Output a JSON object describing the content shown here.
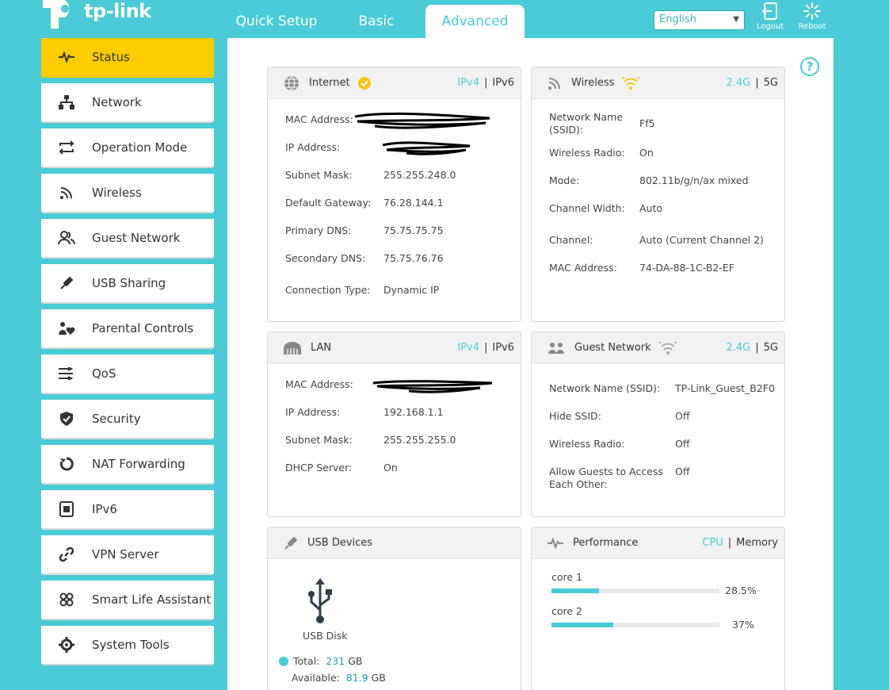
{
  "header": {
    "logo_text": "tp-link",
    "tabs": [
      {
        "label": "Quick Setup"
      },
      {
        "label": "Basic"
      },
      {
        "label": "Advanced"
      }
    ],
    "language": "English",
    "logout_label": "Logout",
    "reboot_label": "Reboot"
  },
  "sidebar": {
    "items": [
      {
        "label": "Status",
        "icon": "pulse-icon"
      },
      {
        "label": "Network",
        "icon": "network-icon"
      },
      {
        "label": "Operation Mode",
        "icon": "mode-icon"
      },
      {
        "label": "Wireless",
        "icon": "wireless-icon"
      },
      {
        "label": "Guest Network",
        "icon": "guest-icon"
      },
      {
        "label": "USB Sharing",
        "icon": "usb-icon"
      },
      {
        "label": "Parental Controls",
        "icon": "parental-icon"
      },
      {
        "label": "QoS",
        "icon": "qos-icon"
      },
      {
        "label": "Security",
        "icon": "shield-icon"
      },
      {
        "label": "NAT Forwarding",
        "icon": "nat-icon"
      },
      {
        "label": "IPv6",
        "icon": "ipv6-icon"
      },
      {
        "label": "VPN Server",
        "icon": "link-icon"
      },
      {
        "label": "Smart Life Assistant",
        "icon": "clover-icon"
      },
      {
        "label": "System Tools",
        "icon": "gear-icon"
      }
    ]
  },
  "help_label": "?",
  "internet": {
    "title": "Internet",
    "tab_ipv4": "IPv4",
    "tab_ipv6": "IPv6",
    "sep": "|",
    "labels": {
      "mac": "MAC Address:",
      "ip": "IP Address:",
      "subnet": "Subnet Mask:",
      "gateway": "Default Gateway:",
      "dns1": "Primary DNS:",
      "dns2": "Secondary DNS:",
      "conn": "Connection Type:"
    },
    "values": {
      "subnet": "255.255.248.0",
      "gateway": "76.28.144.1",
      "dns1": "75.75.75.75",
      "dns2": "75.75.76.76",
      "conn": "Dynamic IP"
    }
  },
  "wireless": {
    "title": "Wireless",
    "tab_24": "2.4G",
    "tab_5": "5G",
    "sep": "|",
    "labels": {
      "ssid_1": "Network Name",
      "ssid_2": "(SSID):",
      "radio": "Wireless Radio:",
      "mode": "Mode:",
      "width": "Channel Width:",
      "channel": "Channel:",
      "mac": "MAC Address:"
    },
    "values": {
      "ssid": "Ff5",
      "radio": "On",
      "mode": "802.11b/g/n/ax mixed",
      "width": "Auto",
      "channel": "Auto (Current Channel 2)",
      "mac": "74-DA-88-1C-B2-EF"
    }
  },
  "lan": {
    "title": "LAN",
    "tab_ipv4": "IPv4",
    "tab_ipv6": "IPv6",
    "sep": "|",
    "labels": {
      "mac": "MAC Address:",
      "ip": "IP Address:",
      "subnet": "Subnet Mask:",
      "dhcp": "DHCP Server:"
    },
    "values": {
      "ip": "192.168.1.1",
      "subnet": "255.255.255.0",
      "dhcp": "On"
    }
  },
  "guest": {
    "title": "Guest Network",
    "tab_24": "2.4G",
    "tab_5": "5G",
    "sep": "|",
    "labels": {
      "ssid": "Network Name (SSID):",
      "hide": "Hide SSID:",
      "radio": "Wireless Radio:",
      "allow_1": "Allow Guests to Access",
      "allow_2": "Each Other:"
    },
    "values": {
      "ssid": "TP-Link_Guest_B2F0",
      "hide": "Off",
      "radio": "Off",
      "allow": "Off"
    }
  },
  "usb": {
    "title": "USB Devices",
    "device_label": "USB Disk",
    "total_label": "Total:",
    "total_value": "231",
    "total_unit": "GB",
    "avail_label": "Available:",
    "avail_value": "81.9",
    "avail_unit": "GB"
  },
  "performance": {
    "title": "Performance",
    "tab_cpu": "CPU",
    "tab_mem": "Memory",
    "sep": "|",
    "cores": [
      {
        "label": "core 1",
        "value_text": "28.5%",
        "fraction": 0.285
      },
      {
        "label": "core 2",
        "value_text": "37%",
        "fraction": 0.37
      }
    ]
  },
  "colors": {
    "accent": "#4acbd6",
    "active_nav": "#fccb00",
    "check": "#f5c518"
  }
}
